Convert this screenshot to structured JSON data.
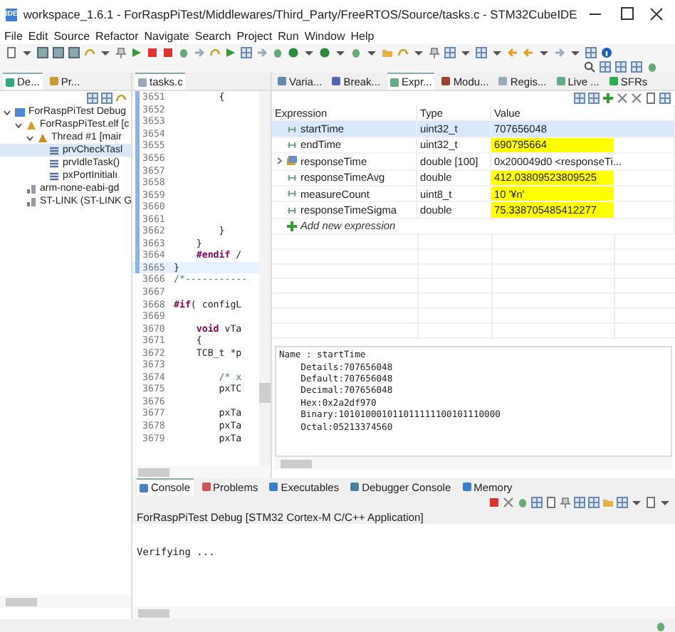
{
  "window": {
    "app_badge": "IDE",
    "title": "workspace_1.6.1 - ForRaspPiTest/Middlewares/Third_Party/FreeRTOS/Source/tasks.c - STM32CubeIDE"
  },
  "menu": [
    "File",
    "Edit",
    "Source",
    "Refactor",
    "Navigate",
    "Search",
    "Project",
    "Run",
    "Window",
    "Help"
  ],
  "debug_view": {
    "tabs": [
      {
        "label": "De...",
        "selected": true
      },
      {
        "label": "Pr...",
        "selected": false
      }
    ],
    "tree": [
      {
        "label": "ForRaspPiTest Debug",
        "kind": "launch",
        "expanded": true,
        "selected": false,
        "children": [
          {
            "label": "ForRaspPiTest.elf [c",
            "kind": "process",
            "expanded": true,
            "selected": false,
            "children": [
              {
                "label": "Thread #1 [mair",
                "kind": "thread",
                "expanded": true,
                "selected": false,
                "children": [
                  {
                    "label": "prvCheckTasl",
                    "kind": "frame",
                    "selected": true
                  },
                  {
                    "label": "prvIdleTask()",
                    "kind": "frame",
                    "selected": false
                  },
                  {
                    "label": "pxPortInitialı",
                    "kind": "frame",
                    "selected": false
                  }
                ]
              }
            ]
          },
          {
            "label": "arm-none-eabi-gd",
            "kind": "tool",
            "selected": false
          },
          {
            "label": "ST-LINK (ST-LINK G",
            "kind": "tool",
            "selected": false
          }
        ]
      }
    ]
  },
  "editor": {
    "tab": "tasks.c",
    "lines": [
      {
        "number": "3651",
        "in_block": true,
        "current": false,
        "parts": [
          {
            "text": "        {",
            "kind": "plain"
          }
        ]
      },
      {
        "number": "3652",
        "in_block": true,
        "current": false
      },
      {
        "number": "3653",
        "in_block": true,
        "current": false
      },
      {
        "number": "3654",
        "in_block": true,
        "current": false
      },
      {
        "number": "3655",
        "in_block": true,
        "current": false
      },
      {
        "number": "3656",
        "in_block": true,
        "current": false
      },
      {
        "number": "3657",
        "in_block": true,
        "current": false
      },
      {
        "number": "3658",
        "in_block": true,
        "current": false
      },
      {
        "number": "3659",
        "in_block": true,
        "current": false
      },
      {
        "number": "3660",
        "in_block": true,
        "current": false
      },
      {
        "number": "3661",
        "in_block": true,
        "current": false
      },
      {
        "number": "3662",
        "in_block": true,
        "current": false,
        "parts": [
          {
            "text": "        }",
            "kind": "plain"
          }
        ]
      },
      {
        "number": "3663",
        "in_block": true,
        "current": false,
        "parts": [
          {
            "text": "    }",
            "kind": "plain"
          }
        ]
      },
      {
        "number": "3664",
        "in_block": true,
        "current": false,
        "parts": [
          {
            "text": "    #endif",
            "kind": "keyword"
          },
          {
            "text": " /",
            "kind": "plain"
          }
        ]
      },
      {
        "number": "3665",
        "in_block": true,
        "current": true,
        "parts": [
          {
            "text": "}",
            "kind": "plain"
          }
        ]
      },
      {
        "number": "3666",
        "in_block": false,
        "current": false,
        "parts": [
          {
            "text": "/*-----------",
            "kind": "comment"
          }
        ]
      },
      {
        "number": "3667",
        "in_block": false,
        "current": false
      },
      {
        "number": "3668",
        "in_block": false,
        "current": false,
        "parts": [
          {
            "text": "#if",
            "kind": "keyword"
          },
          {
            "text": "( configL",
            "kind": "plain"
          }
        ]
      },
      {
        "number": "3669",
        "in_block": false,
        "current": false
      },
      {
        "number": "3670",
        "in_block": false,
        "current": false,
        "parts": [
          {
            "text": "    void",
            "kind": "keyword"
          },
          {
            "text": " vTa",
            "kind": "plain"
          }
        ]
      },
      {
        "number": "3671",
        "in_block": false,
        "current": false,
        "parts": [
          {
            "text": "    {",
            "kind": "plain"
          }
        ]
      },
      {
        "number": "3672",
        "in_block": false,
        "current": false,
        "parts": [
          {
            "text": "    TCB_t *p",
            "kind": "plain"
          }
        ]
      },
      {
        "number": "3673",
        "in_block": false,
        "current": false
      },
      {
        "number": "3674",
        "in_block": false,
        "current": false,
        "parts": [
          {
            "text": "        /* x",
            "kind": "comment"
          }
        ]
      },
      {
        "number": "3675",
        "in_block": false,
        "current": false,
        "parts": [
          {
            "text": "        pxTC",
            "kind": "plain"
          }
        ]
      },
      {
        "number": "3676",
        "in_block": false,
        "current": false
      },
      {
        "number": "3677",
        "in_block": false,
        "current": false,
        "parts": [
          {
            "text": "        pxTa",
            "kind": "plain"
          }
        ]
      },
      {
        "number": "3678",
        "in_block": false,
        "current": false,
        "parts": [
          {
            "text": "        pxTa",
            "kind": "plain"
          }
        ]
      },
      {
        "number": "3679",
        "in_block": false,
        "current": false,
        "parts": [
          {
            "text": "        pxTa",
            "kind": "plain"
          }
        ]
      }
    ]
  },
  "expressions_view": {
    "tabs": [
      {
        "label": "Varia...",
        "selected": false
      },
      {
        "label": "Break...",
        "selected": false
      },
      {
        "label": "Expr...",
        "selected": true
      },
      {
        "label": "Modu...",
        "selected": false
      },
      {
        "label": "Regis...",
        "selected": false
      },
      {
        "label": "Live ...",
        "selected": false
      },
      {
        "label": "SFRs",
        "selected": false
      }
    ],
    "columns": [
      "Expression",
      "Type",
      "Value"
    ],
    "rows": [
      {
        "expression": "startTime",
        "type": "uint32_t",
        "value": "707656048",
        "changed": false,
        "selected": true,
        "expandable": false
      },
      {
        "expression": "endTime",
        "type": "uint32_t",
        "value": "690795664",
        "changed": true,
        "selected": false,
        "expandable": false
      },
      {
        "expression": "responseTime",
        "type": "double [100]",
        "value": "0x200049d0 <responseTi...",
        "changed": false,
        "selected": false,
        "expandable": true
      },
      {
        "expression": "responseTimeAvg",
        "type": "double",
        "value": "412.03809523809525",
        "changed": true,
        "selected": false,
        "expandable": false
      },
      {
        "expression": "measureCount",
        "type": "uint8_t",
        "value": "10 '¥n'",
        "changed": true,
        "selected": false,
        "expandable": false
      },
      {
        "expression": "responseTimeSigma",
        "type": "double",
        "value": "75.338705485412277",
        "changed": true,
        "selected": false,
        "expandable": false
      }
    ],
    "add_expression": "Add new expression",
    "details": [
      "Name : startTime",
      "    Details:707656048",
      "    Default:707656048",
      "    Decimal:707656048",
      "    Hex:0x2a2df970",
      "    Binary:101010001011011111100101110000",
      "    Octal:05213374560"
    ]
  },
  "console_view": {
    "tabs": [
      {
        "label": "Console",
        "selected": true
      },
      {
        "label": "Problems",
        "selected": false
      },
      {
        "label": "Executables",
        "selected": false
      },
      {
        "label": "Debugger Console",
        "selected": false
      },
      {
        "label": "Memory",
        "selected": false
      }
    ],
    "launch": "ForRaspPiTest Debug [STM32 Cortex-M C/C++ Application]",
    "output": "Verifying ..."
  }
}
